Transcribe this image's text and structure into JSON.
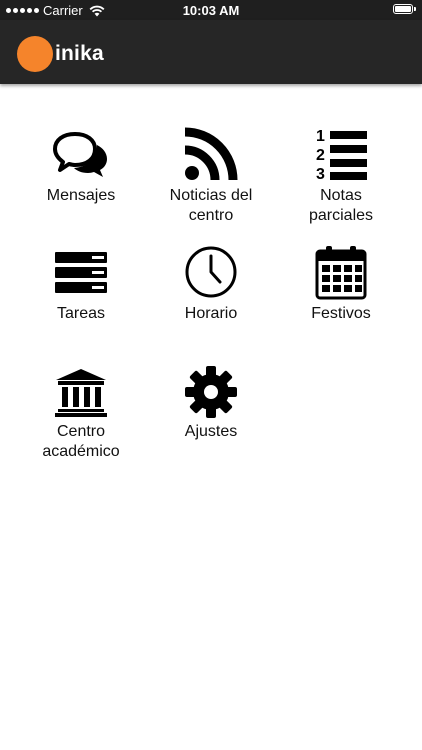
{
  "status": {
    "carrier": "Carrier",
    "time": "10:03 AM"
  },
  "header": {
    "brand": "inika",
    "brand_color": "#f5842b"
  },
  "menu": [
    {
      "label": "Mensajes",
      "icon": "chat-bubbles-icon"
    },
    {
      "label": "Noticias del\ncentro",
      "icon": "rss-icon"
    },
    {
      "label": "Notas\nparciales",
      "icon": "numbered-list-icon"
    },
    {
      "label": "Tareas",
      "icon": "server-stack-icon"
    },
    {
      "label": "Horario",
      "icon": "clock-icon"
    },
    {
      "label": "Festivos",
      "icon": "calendar-icon"
    },
    {
      "label": "Centro\nacadémico",
      "icon": "institution-icon"
    },
    {
      "label": "Ajustes",
      "icon": "gear-icon"
    }
  ]
}
